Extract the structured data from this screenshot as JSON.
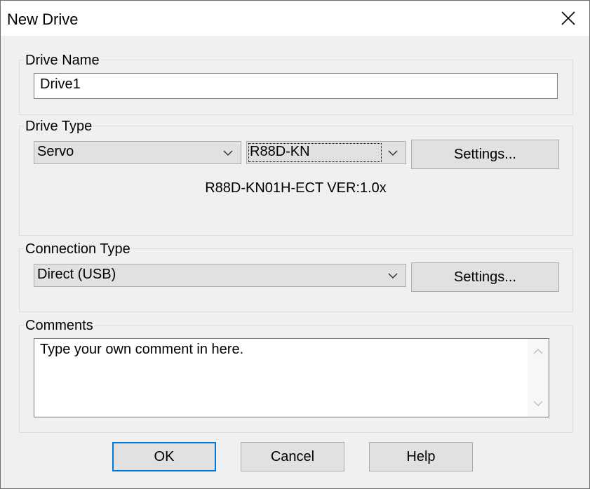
{
  "window": {
    "title": "New Drive"
  },
  "drive_name": {
    "label": "Drive Name",
    "value": "Drive1"
  },
  "drive_type": {
    "label": "Drive Type",
    "type_value": "Servo",
    "model_value": "R88D-KN",
    "settings_label": "Settings...",
    "info": "R88D-KN01H-ECT VER:1.0x"
  },
  "connection_type": {
    "label": "Connection Type",
    "value": "Direct (USB)",
    "settings_label": "Settings..."
  },
  "comments": {
    "label": "Comments",
    "value": "Type your own comment in here."
  },
  "buttons": {
    "ok": "OK",
    "cancel": "Cancel",
    "help": "Help"
  },
  "icons": {
    "close": "close-icon",
    "dropdown": "chevron-down-icon",
    "scroll_up": "chevron-up-icon",
    "scroll_down": "chevron-down-icon"
  },
  "colors": {
    "default_button_border": "#0078d7",
    "button_face": "#e1e1e1"
  }
}
